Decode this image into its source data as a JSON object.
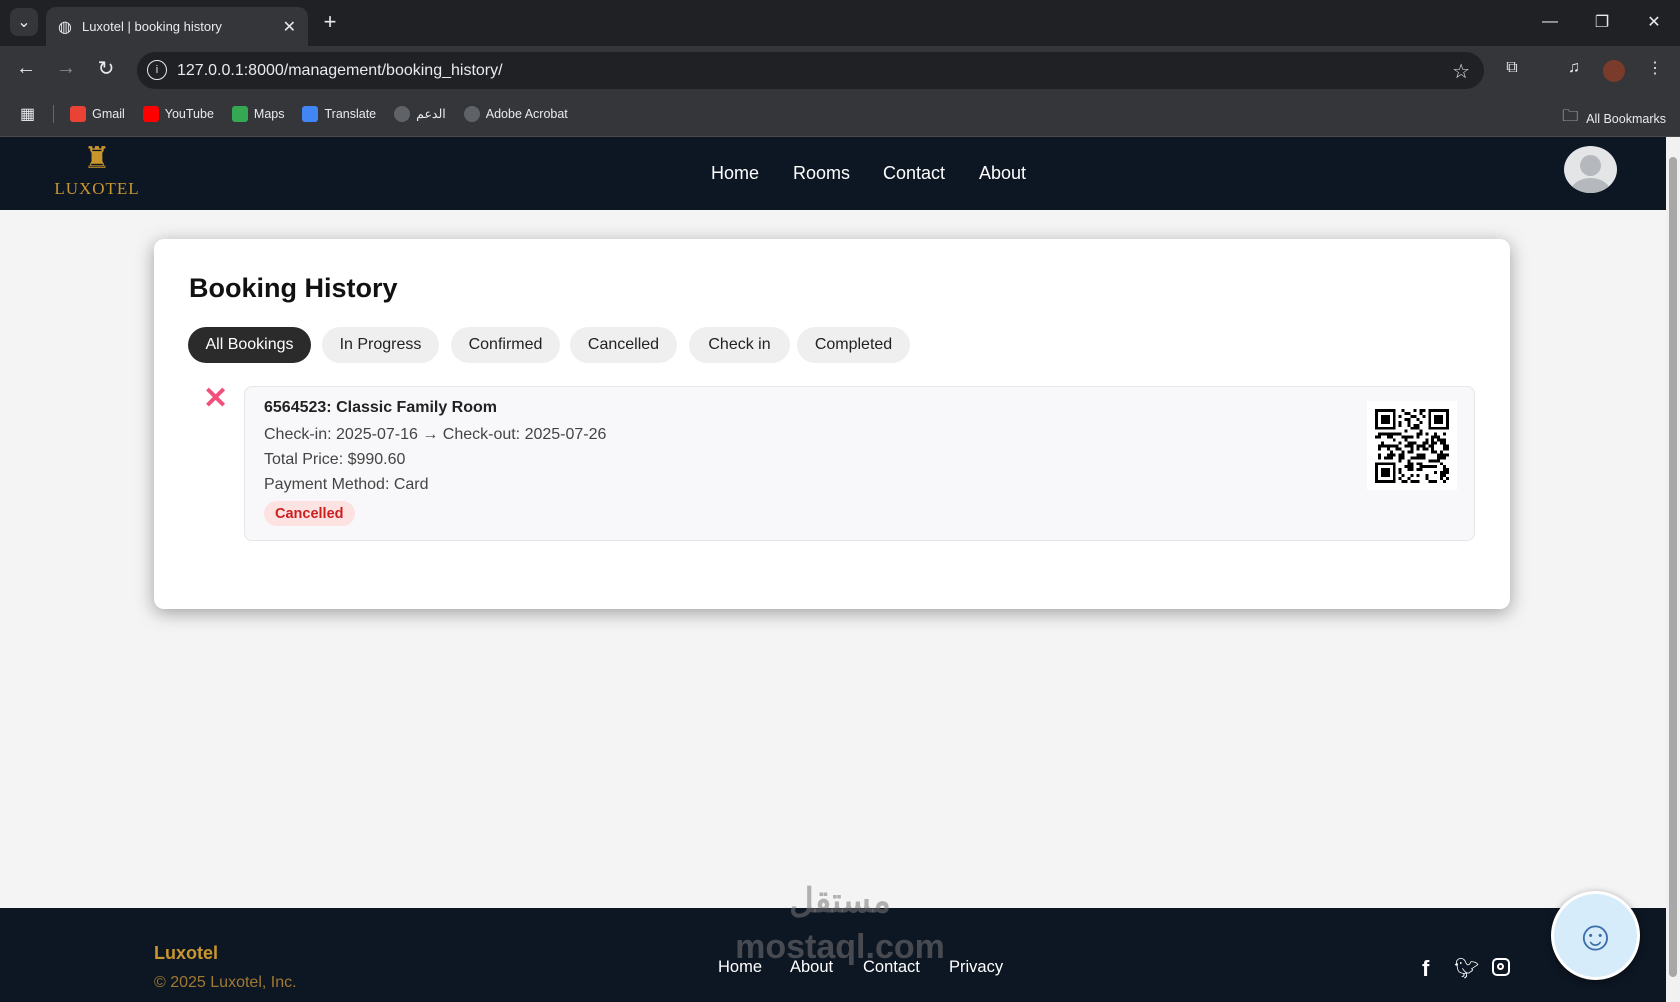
{
  "browser": {
    "tab_title": "Luxotel | booking history",
    "url": "127.0.0.1:8000/management/booking_history/",
    "bookmarks": [
      {
        "label": "Gmail",
        "icon": "gmail-icon",
        "color": "#ea4335"
      },
      {
        "label": "YouTube",
        "icon": "youtube-icon",
        "color": "#ff0000"
      },
      {
        "label": "Maps",
        "icon": "maps-icon",
        "color": "#34a853"
      },
      {
        "label": "Translate",
        "icon": "translate-icon",
        "color": "#4285f4"
      },
      {
        "label": "الدعم",
        "icon": "globe-icon",
        "color": "#5f6368"
      },
      {
        "label": "Adobe Acrobat",
        "icon": "globe-icon",
        "color": "#5f6368"
      }
    ],
    "all_bookmarks": "All Bookmarks"
  },
  "header": {
    "logo": "LUXOTEL",
    "nav": [
      "Home",
      "Rooms",
      "Contact",
      "About"
    ],
    "brand_color": "#c9962e"
  },
  "main": {
    "title": "Booking History",
    "filters": [
      {
        "label": "All Bookings",
        "active": true
      },
      {
        "label": "In Progress"
      },
      {
        "label": "Confirmed"
      },
      {
        "label": "Cancelled"
      },
      {
        "label": "Check in"
      },
      {
        "label": "Completed"
      }
    ],
    "bookings": [
      {
        "title": "6564523: Classic Family Room",
        "dates": "Check-in: 2025-07-16 → Check-out: 2025-07-26",
        "price": "Total Price: $990.60",
        "payment": "Payment Method: Card",
        "status": "Cancelled",
        "status_color": "#cc1f1f"
      }
    ]
  },
  "footer": {
    "brand": "Luxotel",
    "copyright": "© 2025 Luxotel, Inc.",
    "links": [
      "Home",
      "About",
      "Contact",
      "Privacy"
    ],
    "social": [
      "facebook-icon",
      "twitter-icon",
      "instagram-icon"
    ],
    "watermark": "مستقل mostaql.com"
  }
}
